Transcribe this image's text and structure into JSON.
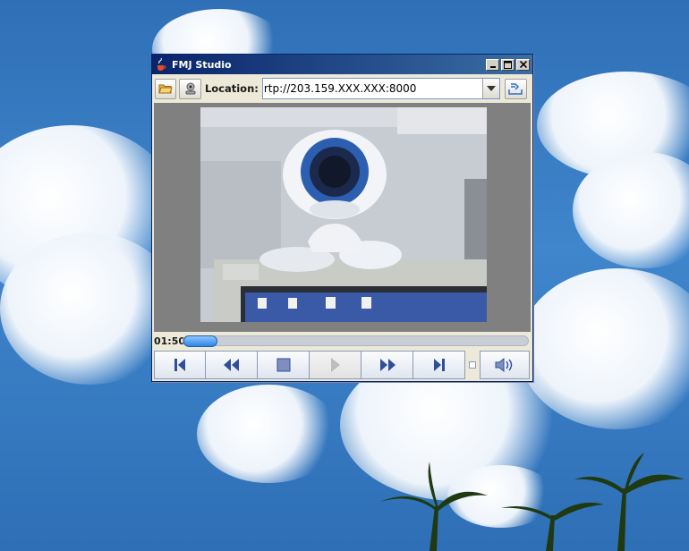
{
  "window": {
    "title": "FMJ Studio"
  },
  "toolbar": {
    "location_label": "Location:",
    "location_value": "rtp://203.159.XXX.XXX:8000"
  },
  "player": {
    "time": "01:50",
    "progress": 0.0
  },
  "icons": {
    "app": "java-cup-icon",
    "open_file": "folder-open-icon",
    "capture": "webcam-icon",
    "dropdown": "chevron-down-icon",
    "open_location": "open-location-icon"
  },
  "controls": [
    "step-back",
    "rewind",
    "stop",
    "play",
    "fast-forward",
    "step-forward",
    "volume"
  ],
  "colors": {
    "title_start": "#0a246a",
    "title_end": "#3a6ea5",
    "seek_thumb": "#2d86e8",
    "video_bg": "#808080"
  }
}
